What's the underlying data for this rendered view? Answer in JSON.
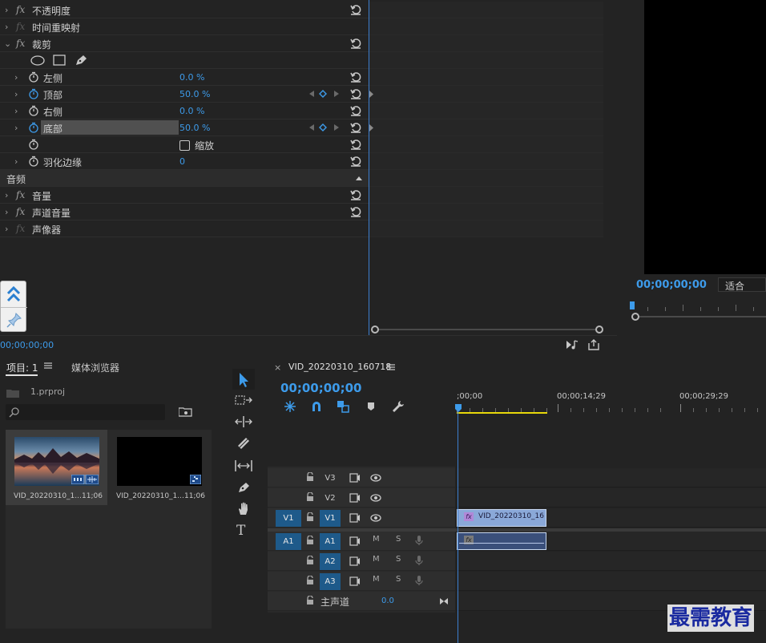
{
  "effects": {
    "opacity": {
      "label": "不透明度"
    },
    "time_remap": {
      "label": "时间重映射"
    },
    "crop": {
      "label": "裁剪",
      "left": {
        "label": "左侧",
        "value": "0.0 %"
      },
      "top": {
        "label": "顶部",
        "value": "50.0 %"
      },
      "right": {
        "label": "右侧",
        "value": "0.0 %"
      },
      "bottom": {
        "label": "底部",
        "value": "50.0 %"
      },
      "zoom": {
        "label": "缩放"
      },
      "feather": {
        "label": "羽化边缘",
        "value": "0"
      }
    },
    "fx_symbol": "fx",
    "audio_header": "音频",
    "volume": {
      "label": "音量"
    },
    "channel_volume": {
      "label": "声道音量"
    },
    "panner": {
      "label": "声像器"
    },
    "timecode": "00;00;00;00"
  },
  "program": {
    "timecode": "00;00;00;00",
    "fit_label": "适合"
  },
  "project": {
    "tab_label": "项目: 1",
    "tab2_label": "媒体浏览器",
    "file_name": "1.prproj",
    "search_placeholder": "",
    "items": [
      {
        "name": "VID_20220310_1...",
        "duration": "11;06"
      },
      {
        "name": "VID_20220310_1...",
        "duration": "11;06"
      }
    ]
  },
  "timeline": {
    "close_symbol": "×",
    "sequence_name": "VID_20220310_160718",
    "timecode": "00;00;00;00",
    "ruler": [
      ";00;00",
      "00;00;14;29",
      "00;00;29;29"
    ],
    "tracks": {
      "v3": "V3",
      "v2": "V2",
      "v1": "V1",
      "a1": "A1",
      "a2": "A2",
      "a3": "A3",
      "mute": "M",
      "solo": "S"
    },
    "master_label": "主声道",
    "master_value": "0.0",
    "clip_video_name": "VID_20220310_16",
    "clip_fx": "fx"
  },
  "watermark": "最需教育",
  "colors": {
    "accent": "#3d9bea",
    "playhead": "#3d7fd0",
    "track_on": "#1e5a8a",
    "clip_video": "#8aa8d8",
    "clip_audio": "#3a4f7a",
    "work_area": "#e8d80a",
    "watermark": "#1a2aa0"
  }
}
